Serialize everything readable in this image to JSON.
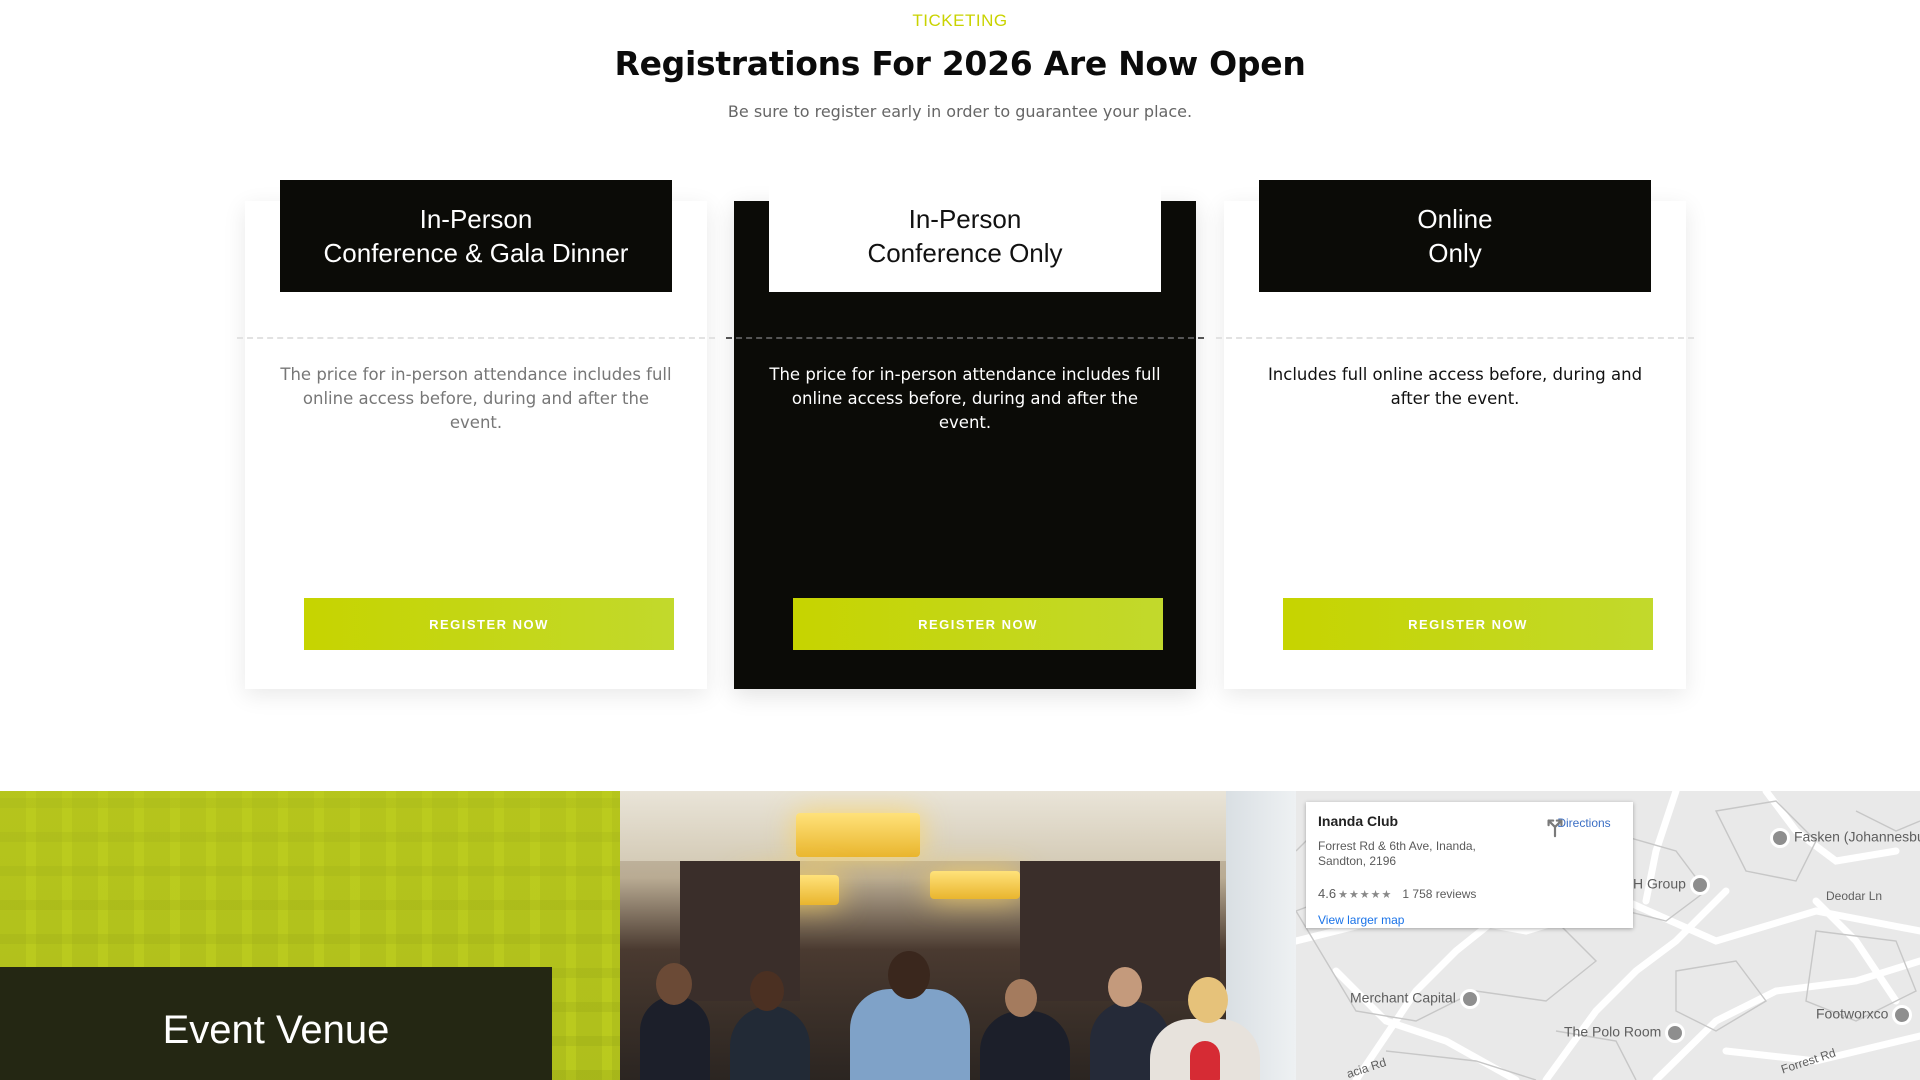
{
  "header": {
    "eyebrow": "TICKETING",
    "title": "Registrations For 2026 Are Now Open",
    "subtitle": "Be sure to register early in order to guarantee your place."
  },
  "cards": [
    {
      "title_line1": "In-Person",
      "title_line2": "Conference & Gala Dinner",
      "description": "The price for in-person attendance includes full online access before, during and after the event.",
      "button": "REGISTER NOW"
    },
    {
      "title_line1": "In-Person",
      "title_line2": "Conference Only",
      "description": "The price for in-person attendance includes full online access before, during and after the event.",
      "button": "REGISTER NOW"
    },
    {
      "title_line1": "Online",
      "title_line2": "Only",
      "description": "Includes full online access before, during and after the event.",
      "button": "REGISTER NOW"
    }
  ],
  "venue": {
    "label": "Event Venue"
  },
  "map": {
    "place_name": "Inanda Club",
    "address": "Forrest Rd & 6th Ave, Inanda, Sandton, 2196",
    "rating": "4.6",
    "stars_icon": "star-rating-icon",
    "reviews": "1 758 reviews",
    "larger_map": "View larger map",
    "directions": "Directions",
    "labels": {
      "fasken": "Fasken (Johannesbu",
      "hgroup": "H Group",
      "deodar": "Deodar Ln",
      "merchant": "Merchant Capital",
      "polo": "The Polo Room",
      "footworxco": "Footworxco",
      "forrest": "Forrest Rd",
      "acacia": "acia Rd"
    }
  },
  "colors": {
    "accent": "#c6d400",
    "dark": "#0b0b07",
    "venue_green": "#b8c91e"
  }
}
